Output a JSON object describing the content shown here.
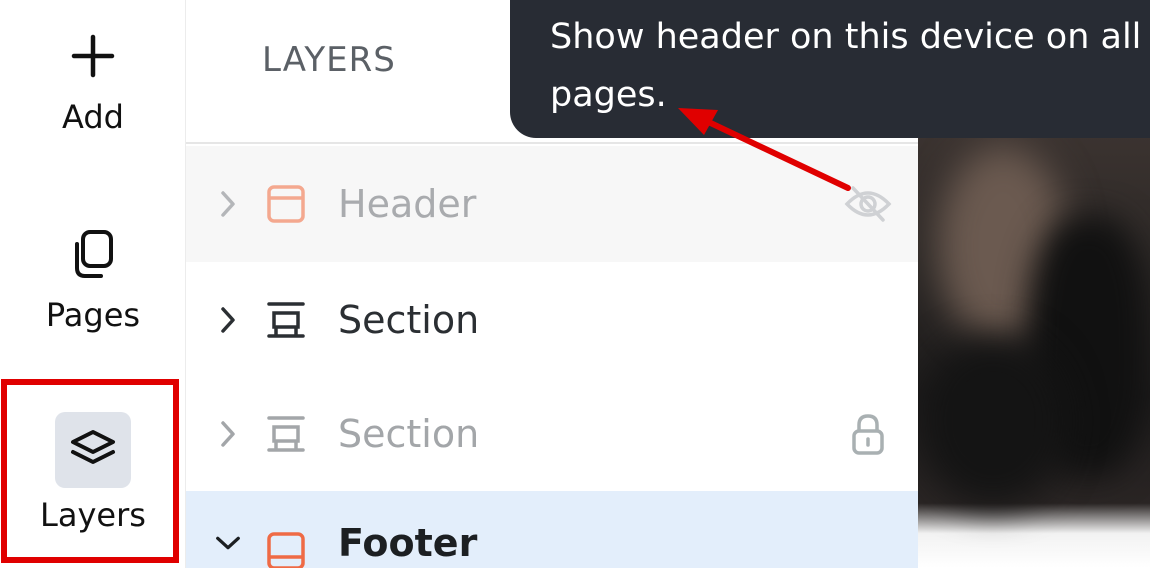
{
  "rail": {
    "add_label": "Add",
    "pages_label": "Pages",
    "layers_label": "Layers"
  },
  "panel": {
    "title": "LAYERS",
    "rows": [
      {
        "label": "Header",
        "state": "hidden",
        "icon": "header-block-icon"
      },
      {
        "label": "Section",
        "state": "visible",
        "icon": "section-block-icon"
      },
      {
        "label": "Section",
        "state": "locked",
        "icon": "section-block-icon"
      },
      {
        "label": "Footer",
        "state": "expanded",
        "icon": "footer-block-icon"
      }
    ]
  },
  "tooltip": {
    "text": "Show header on this device on all pages."
  },
  "colors": {
    "accent_orange": "#ef6a45",
    "tooltip_bg": "#282c34",
    "selection_bg": "#e3eefb",
    "annotation_red": "#e00000"
  }
}
